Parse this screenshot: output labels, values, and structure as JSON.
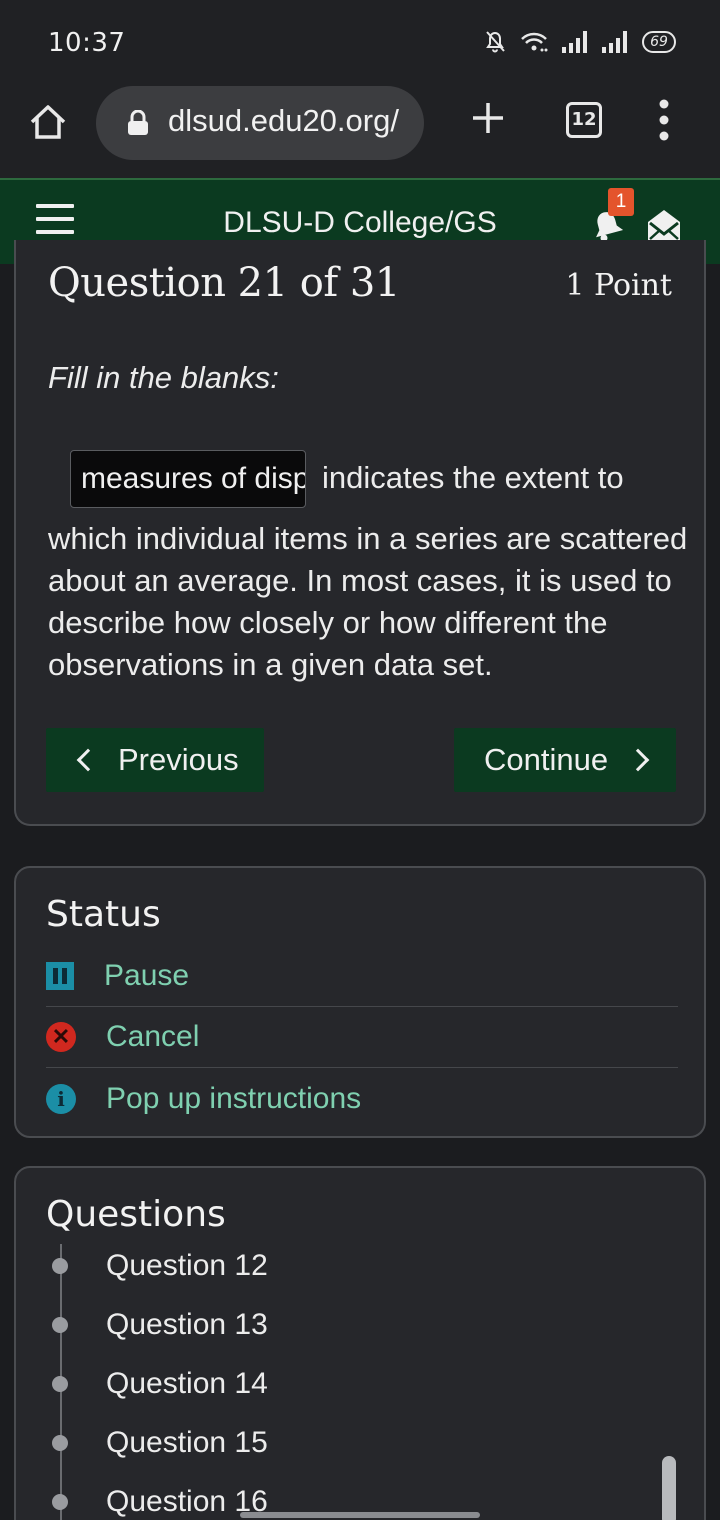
{
  "status_bar": {
    "time": "10:37",
    "battery": "69",
    "icons": [
      "mute-icon",
      "wifi-icon",
      "signal-icon",
      "signal-icon",
      "battery-icon"
    ]
  },
  "browser": {
    "url": "dlsud.edu20.org/",
    "tab_count": "12",
    "icons": [
      "home-icon",
      "lock-icon",
      "plus-icon",
      "tabs-icon",
      "more-icon"
    ]
  },
  "site": {
    "title": "DLSU-D College/GS",
    "notification_count": "1",
    "icons": [
      "menu-icon",
      "bell-icon",
      "mail-icon"
    ]
  },
  "question": {
    "title": "Question 21 of 31",
    "points": "1 Point",
    "instruction": "Fill in the blanks:",
    "blank_value": "measures of dispersion",
    "text_after_blank": "indicates the extent to",
    "body": "which individual items in a series are scattered about an average. In most cases, it is used to describe how closely or how different the observations in a given data set.",
    "prev_label": "Previous",
    "next_label": "Continue"
  },
  "status_panel": {
    "heading": "Status",
    "items": [
      {
        "label": "Pause",
        "icon": "pause-icon"
      },
      {
        "label": "Cancel",
        "icon": "cancel-icon"
      },
      {
        "label": "Pop up instructions",
        "icon": "info-icon"
      }
    ]
  },
  "questions_panel": {
    "heading": "Questions",
    "items": [
      "Question 12",
      "Question 13",
      "Question 14",
      "Question 15",
      "Question 16"
    ]
  },
  "colors": {
    "header_green": "#0b3a20",
    "button_green": "#0b3a20",
    "link_teal": "#7fd0b0",
    "badge_orange": "#e4542c",
    "card_bg": "#26272b"
  }
}
